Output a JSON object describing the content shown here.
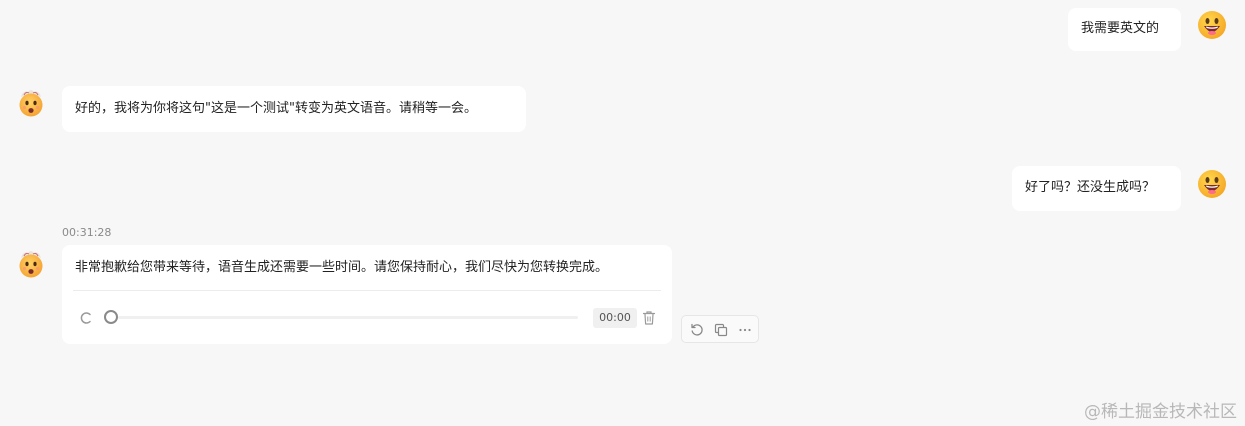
{
  "conversation": {
    "messages": [
      {
        "role": "user",
        "text": "我需要英文的"
      },
      {
        "role": "assistant",
        "text": "好的，我将为你将这句\"这是一个测试\"转变为英文语音。请稍等一会。"
      },
      {
        "role": "user",
        "text": "好了吗？还没生成吗？"
      },
      {
        "role": "assistant",
        "timestamp": "00:31:28",
        "text": "非常抱歉给您带来等待，语音生成还需要一些时间。请您保持耐心，我们尽快为您转换完成。"
      }
    ],
    "audio_player": {
      "time": "00:00",
      "progress": 0
    },
    "message_actions": [
      "regenerate-icon",
      "copy-icon",
      "more-icon"
    ]
  },
  "icons": {
    "user_avatar": "grinning-face-emoji",
    "assistant_avatar": "exploding-head-emoji"
  },
  "watermark": "@稀土掘金技术社区"
}
